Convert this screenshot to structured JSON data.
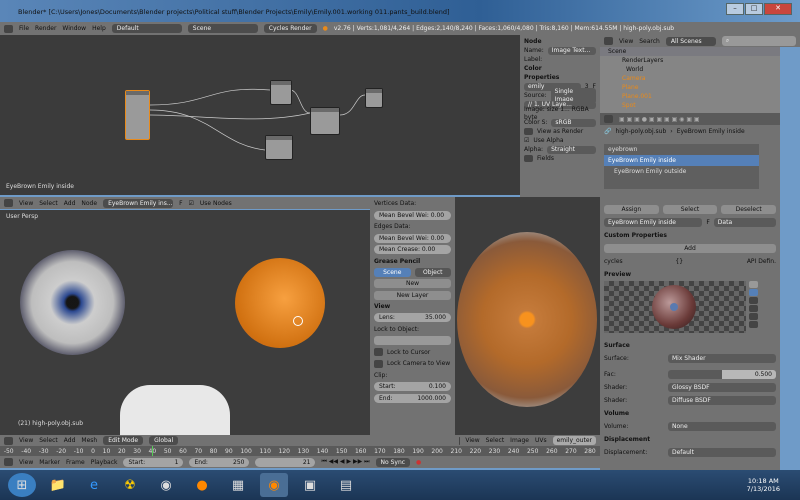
{
  "window": {
    "title": "Blender* [C:\\Users\\Jones\\Documents\\Blender projects\\Political stuff\\Blender Projects\\Emily\\Emily.001.working 011.pants_build.blend]",
    "min": "–",
    "max": "□",
    "close": "✕"
  },
  "info_header": {
    "menus": [
      "File",
      "Render",
      "Window",
      "Help"
    ],
    "layout": "Default",
    "scene": "Scene",
    "engine": "Cycles Render",
    "stats": "v2.76 | Verts:1,081/4,264 | Edges:2,140/8,240 | Faces:1,060/4,080 | Tris:8,160 | Mem:614.55M | high-poly.obj.sub"
  },
  "node_editor": {
    "material_label": "EyeBrown Emily inside",
    "header": {
      "menus": [
        "View",
        "Select",
        "Add",
        "Node"
      ],
      "material": "EyeBrown Emily ins...",
      "fake_user": "F",
      "use_nodes": "Use Nodes"
    }
  },
  "node_panel": {
    "node_section": "Node",
    "name_label": "Name:",
    "name_value": "Image Text...",
    "label_label": "Label:",
    "color_section": "Color",
    "properties_section": "Properties",
    "image_name": "emily",
    "users": "3",
    "fake": "F",
    "source_label": "Source:",
    "source_value": "Single Image",
    "uv_layer": "// 1. UV Laye...",
    "image_info": "Image: size 1... RGBA byte",
    "colorspace_label": "Color S:",
    "colorspace_value": "sRGB",
    "view_as_render": "View as Render",
    "use_alpha": "Use Alpha",
    "alpha_label": "Alpha:",
    "alpha_value": "Straight",
    "fields": "Fields"
  },
  "outliner": {
    "menus": [
      "View",
      "Search"
    ],
    "filter": "All Scenes",
    "items": [
      "Scene",
      "RenderLayers",
      "World",
      "Camera",
      "Plane",
      "Plane.001",
      "Spot"
    ]
  },
  "properties": {
    "breadcrumb": [
      "high-poly.obj.sub",
      "EyeBrown Emily inside"
    ],
    "slots": [
      "eyebrown",
      "EyeBrown Emily inside",
      "EyeBrown Emily outside"
    ],
    "assign": "Assign",
    "select": "Select",
    "deselect": "Deselect",
    "material": "EyeBrown Emily inside",
    "material_f": "F",
    "link": "Data",
    "custom_props": "Custom Properties",
    "add": "Add",
    "cycles": "cycles",
    "cycles_val": "{}",
    "api_defined": "API Defin.",
    "preview": "Preview",
    "surface_section": "Surface",
    "surface_label": "Surface:",
    "surface_value": "Mix Shader",
    "fac_label": "Fac:",
    "fac_value": "0.500",
    "fac_fraction": 0.5,
    "shader_label": "Shader:",
    "shader1": "Glossy BSDF",
    "shader2": "Diffuse BSDF",
    "volume_section": "Volume",
    "volume_label": "Volume:",
    "volume_value": "None",
    "displacement_section": "Displacement",
    "displacement_label": "Displacement:",
    "displacement_value": "Default"
  },
  "viewport": {
    "view_name": "User Persp",
    "object_label": "(21) high-poly.obj.sub",
    "header": {
      "menus": [
        "View",
        "Select",
        "Add",
        "Mesh"
      ],
      "mode": "Edit Mode",
      "orientation": "Global"
    }
  },
  "npanel": {
    "vertices_data": "Vertices Data:",
    "v_bevel": "Mean Bevel Wei: 0.00",
    "edges_data": "Edges Data:",
    "e_bevel": "Mean Bevel Wei: 0.00",
    "crease": "Mean Crease: 0.00",
    "grease_pencil": "Grease Pencil",
    "scene": "Scene",
    "object": "Object",
    "new": "New",
    "new_layer": "New Layer",
    "view": "View",
    "lens_label": "Lens:",
    "lens_value": "35.000",
    "lock_to_object": "Lock to Object:",
    "lock_cursor": "Lock to Cursor",
    "lock_camera": "Lock Camera to View",
    "clip": "Clip:",
    "start_label": "Start:",
    "start_value": "0.100",
    "end_label": "End:",
    "end_value": "1000.000"
  },
  "image_editor": {
    "menus": [
      "View",
      "Select",
      "Image",
      "UVs"
    ],
    "image": "emily_outer"
  },
  "timeline": {
    "ticks": [
      "-50",
      "-40",
      "-30",
      "-20",
      "-10",
      "0",
      "10",
      "20",
      "30",
      "40",
      "50",
      "60",
      "70",
      "80",
      "90",
      "100",
      "110",
      "120",
      "130",
      "140",
      "150",
      "160",
      "170",
      "180",
      "190",
      "200",
      "210",
      "220",
      "230",
      "240",
      "250",
      "260",
      "270",
      "280"
    ],
    "menus": [
      "View",
      "Marker",
      "Frame",
      "Playback"
    ],
    "start_label": "Start:",
    "start": "1",
    "end_label": "End:",
    "end": "250",
    "current": "21",
    "sync": "No Sync"
  },
  "taskbar": {
    "time": "10:18 AM",
    "date": "7/13/2016"
  }
}
